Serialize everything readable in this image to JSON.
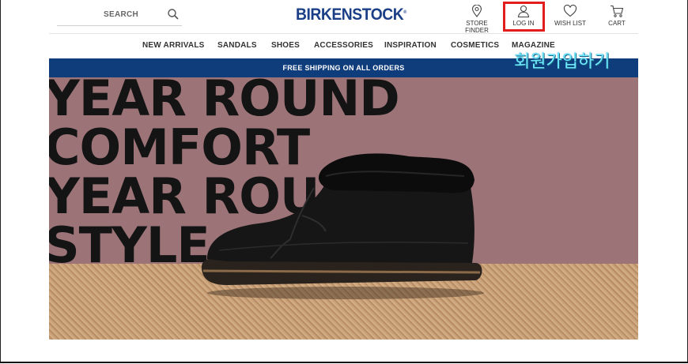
{
  "header": {
    "search_label": "SEARCH",
    "logo": "BIRKENSTOCK",
    "logo_mark": "®",
    "store_finder": "STORE FINDER",
    "login": "LOG IN",
    "wish_list": "WISH LIST",
    "cart": "CART"
  },
  "nav": {
    "items": [
      "NEW ARRIVALS",
      "SANDALS",
      "SHOES",
      "ACCESSORIES",
      "INSPIRATION",
      "COSMETICS",
      "MAGAZINE"
    ]
  },
  "banner": {
    "text": "FREE SHIPPING ON ALL ORDERS"
  },
  "annotation": {
    "korean_text": "회원가입하기",
    "highlight_color": "#e21d1d"
  },
  "hero": {
    "lines": [
      "YEAR ROUND",
      "COMFORT",
      "YEAR ROUND",
      "STYLE"
    ]
  },
  "colors": {
    "brand": "#1b3f86",
    "banner": "#0f3d7c",
    "hero_bg": "#9c7478"
  }
}
